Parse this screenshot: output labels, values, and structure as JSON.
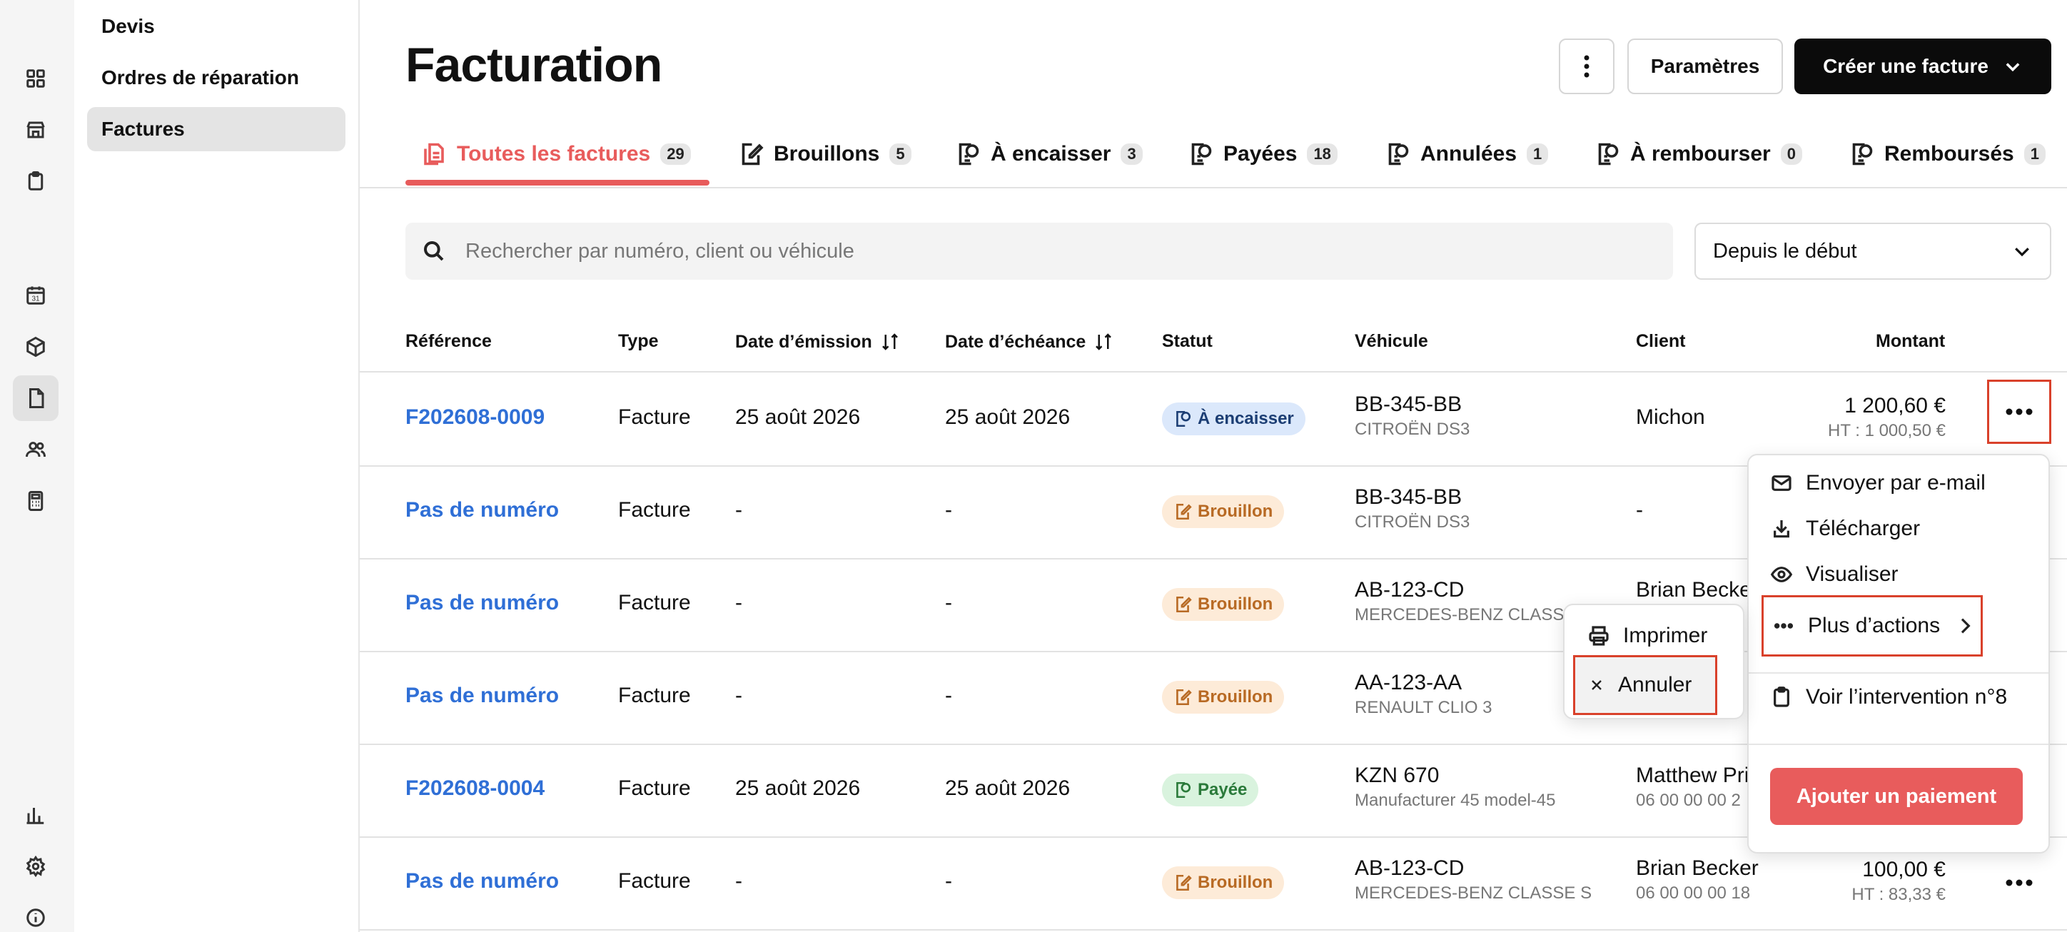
{
  "rail": {
    "icons": [
      "dashboard-icon",
      "store-icon",
      "clipboard-icon",
      "calendar-icon",
      "box-icon",
      "document-icon",
      "users-icon",
      "calculator-icon",
      "chart-icon",
      "settings-icon",
      "info-icon"
    ],
    "calendar_day": "31"
  },
  "subnav": {
    "items": [
      {
        "label": "Devis"
      },
      {
        "label": "Ordres de réparation"
      },
      {
        "label": "Factures"
      }
    ]
  },
  "header": {
    "title": "Facturation",
    "params_label": "Paramètres",
    "create_label": "Créer une facture"
  },
  "tabs": [
    {
      "label": "Toutes les factures",
      "count": "29"
    },
    {
      "label": "Brouillons",
      "count": "5"
    },
    {
      "label": "À encaisser",
      "count": "3"
    },
    {
      "label": "Payées",
      "count": "18"
    },
    {
      "label": "Annulées",
      "count": "1"
    },
    {
      "label": "À rembourser",
      "count": "0"
    },
    {
      "label": "Remboursés",
      "count": "1"
    }
  ],
  "search": {
    "placeholder": "Rechercher par numéro, client ou véhicule"
  },
  "period": {
    "value": "Depuis le début"
  },
  "table": {
    "headers": [
      "Référence",
      "Type",
      "Date d’émission",
      "Date d’échéance",
      "Statut",
      "Véhicule",
      "Client",
      "Montant"
    ],
    "rows": [
      {
        "ref": "F202608-0009",
        "type": "Facture",
        "emission": "25 août 2026",
        "echeance": "25 août 2026",
        "status": "À encaisser",
        "plate": "BB-345-BB",
        "model": "CITROËN DS3",
        "client": "Michon",
        "client_sub": "",
        "amount": "1 200,60 €",
        "ht": "HT : 1 000,50 €"
      },
      {
        "ref": "Pas de numéro",
        "type": "Facture",
        "emission": "-",
        "echeance": "-",
        "status": "Brouillon",
        "plate": "BB-345-BB",
        "model": "CITROËN DS3",
        "client": "-",
        "client_sub": "",
        "amount": "",
        "ht": ""
      },
      {
        "ref": "Pas de numéro",
        "type": "Facture",
        "emission": "-",
        "echeance": "-",
        "status": "Brouillon",
        "plate": "AB-123-CD",
        "model": "MERCEDES-BENZ CLASS",
        "client": "Brian Becke",
        "client_sub": "",
        "amount": "",
        "ht": ""
      },
      {
        "ref": "Pas de numéro",
        "type": "Facture",
        "emission": "-",
        "echeance": "-",
        "status": "Brouillon",
        "plate": "AA-123-AA",
        "model": "RENAULT CLIO 3",
        "client": "",
        "client_sub": "",
        "amount": "",
        "ht": ""
      },
      {
        "ref": "F202608-0004",
        "type": "Facture",
        "emission": "25 août 2026",
        "echeance": "25 août 2026",
        "status": "Payée",
        "plate": "KZN 670",
        "model": "Manufacturer 45 model-45",
        "client": "Matthew Pri",
        "client_sub": "06 00 00 00 2",
        "amount": "",
        "ht": ""
      },
      {
        "ref": "Pas de numéro",
        "type": "Facture",
        "emission": "-",
        "echeance": "-",
        "status": "Brouillon",
        "plate": "AB-123-CD",
        "model": "MERCEDES-BENZ CLASSE S",
        "client": "Brian Becker",
        "client_sub": "06 00 00 00 18",
        "amount": "100,00 €",
        "ht": "HT : 83,33 €"
      }
    ]
  },
  "action_menu": {
    "email": "Envoyer par e-mail",
    "download": "Télécharger",
    "view": "Visualiser",
    "more": "Plus d’actions",
    "intervention": "Voir l’intervention n°8",
    "pay": "Ajouter un paiement"
  },
  "submenu": {
    "print": "Imprimer",
    "cancel": "Annuler"
  },
  "colors": {
    "accent": "#e85c5c",
    "link": "#2f6fd6",
    "highlight": "#d9412b"
  }
}
